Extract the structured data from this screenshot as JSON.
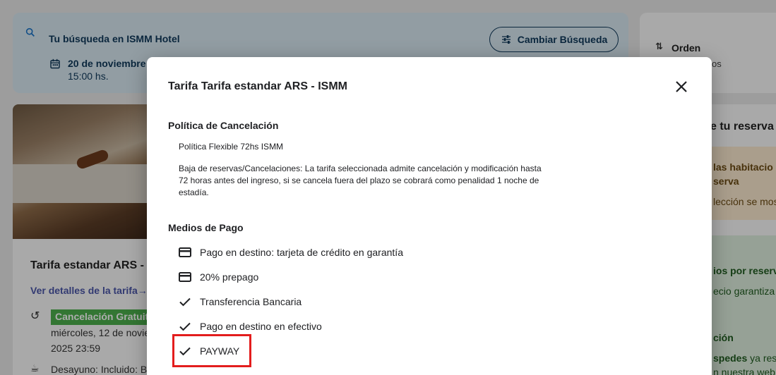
{
  "search": {
    "label": "Tu búsqueda en  ISMM Hotel",
    "change_button": "Cambiar Búsqueda",
    "date": "20 de noviembre",
    "time": "15:00 hs."
  },
  "sort": {
    "label": "Orden",
    "sublabel": "os"
  },
  "hotel_card": {
    "rate_title": "Tarifa estandar ARS -",
    "details_link": "Ver detalles de la tarifa→",
    "free_cancel_badge": "Cancelación Gratuit",
    "cancel_date_line1": "miércoles, 12 de novie",
    "cancel_date_line2": "2025 23:59",
    "breakfast": "Desayuno: Incluido: B"
  },
  "reservation": {
    "title": "e tu reserva",
    "warning_line1": "las habitacio",
    "warning_line2": "serva",
    "warning_line3": "lección se mos",
    "benefit_title": "ios por reserv",
    "benefit_text": "ecio garantiza",
    "info_title": "ción",
    "info_bold": "spedes",
    "info_text": " ya rese",
    "info_text2": "n nuestra web"
  },
  "modal": {
    "title": "Tarifa Tarifa estandar ARS - ISMM",
    "cancel_policy_heading": "Política de Cancelación",
    "policy_name": "Política Flexible 72hs ISMM",
    "policy_text": "Baja de reservas/Cancelaciones: La tarifa seleccionada admite cancelación y modificación hasta 72 horas antes del ingreso, si se cancela fuera del plazo se cobrará como penalidad 1 noche de estadía.",
    "payment_heading": "Medios de Pago",
    "payment_methods": [
      {
        "icon": "credit-card-icon",
        "label": "Pago en destino: tarjeta de crédito en garantía"
      },
      {
        "icon": "credit-card-icon",
        "label": "20% prepago"
      },
      {
        "icon": "check-icon",
        "label": "Transferencia Bancaria"
      },
      {
        "icon": "check-icon",
        "label": "Pago en destino en efectivo"
      },
      {
        "icon": "check-icon",
        "label": "PAYWAY"
      }
    ]
  },
  "colors": {
    "overlay": "#000000",
    "highlight": "#e31d1d",
    "search_bg": "#d8e8f1",
    "badge_green": "#4cae4c",
    "link": "#4b56a8"
  }
}
